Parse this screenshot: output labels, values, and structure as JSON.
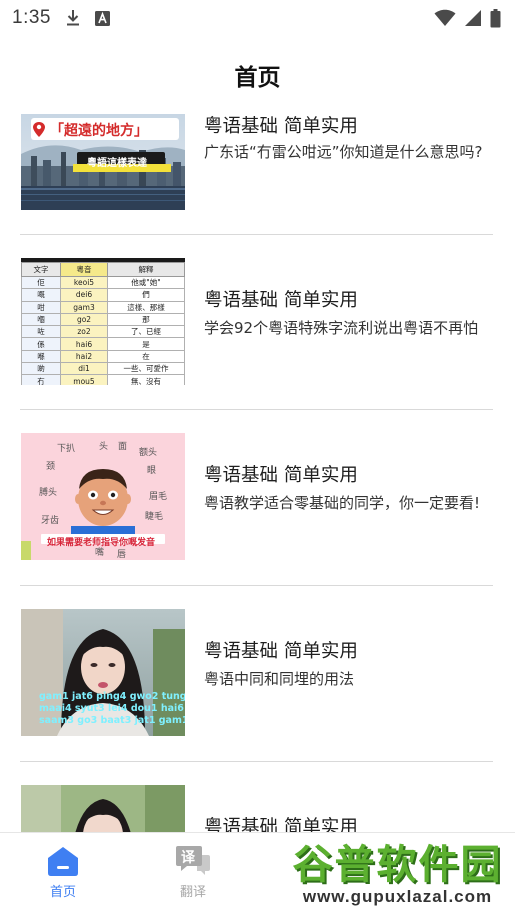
{
  "status_bar": {
    "time": "1:35",
    "icons": [
      "download-icon",
      "font-a-icon",
      "wifi-icon",
      "signal-icon",
      "battery-icon"
    ]
  },
  "header": {
    "title": "首页"
  },
  "items": [
    {
      "title": "粤语基础 简单实用",
      "description": "广东话“冇雷公咁远”你知道是什么意思吗?",
      "thumbnail": {
        "caption": "「超遠的地方」",
        "subcaption": "粵語這樣表達"
      }
    },
    {
      "title": "粤语基础 简单实用",
      "description": "学会92个粤语特殊字流利说出粤语不再怕",
      "thumbnail": {
        "table_header": [
          "文字",
          "粵音",
          "解釋"
        ],
        "table_rows": [
          [
            "佢",
            "keoi5",
            "他或\"她\""
          ],
          [
            "嘅",
            "dei6",
            "們"
          ],
          [
            "咁",
            "gam3",
            "這樣、那樣"
          ],
          [
            "嗰",
            "go2",
            "那"
          ],
          [
            "咗",
            "zo2",
            "了、已經"
          ],
          [
            "係",
            "hai6",
            "是"
          ],
          [
            "喺",
            "hai2",
            "在"
          ],
          [
            "啲",
            "di1",
            "一些、可愛作"
          ],
          [
            "冇",
            "mou5",
            "無、沒有"
          ]
        ]
      }
    },
    {
      "title": "粤语基础 简单实用",
      "description": "粤语教学适合零基础的同学，你一定要看!",
      "thumbnail": {
        "labels": [
          "下扒",
          "头",
          "面",
          "额头",
          "颈",
          "眼",
          "膊头",
          "眉毛",
          "牙齿",
          "睫毛",
          "嘴",
          "唇"
        ],
        "banner": "如果需要老师指导你嘅发音"
      }
    },
    {
      "title": "粤语基础 简单实用",
      "description": "粤语中同和同埋的用法",
      "thumbnail": {
        "subtitle_lines": [
          "gam1 jat6 ping4 gwo2 tung4",
          "maai4 syut3 lei4 dou1 hai6",
          "saam3 go3 baat3 jat1 gam1"
        ]
      }
    },
    {
      "title": "粤语基础 简单实用",
      "description": ""
    }
  ],
  "bottom_nav": {
    "tabs": [
      {
        "label": "首页",
        "icon": "home-icon",
        "active": true
      },
      {
        "label": "翻译",
        "icon": "translate-chat-icon",
        "active": false,
        "icon_text": "译"
      }
    ]
  },
  "watermark": {
    "brand": "谷普软件园",
    "url": "www.gupuxlazal.com"
  },
  "colors": {
    "accent": "#3f7ff2",
    "inactive": "#a8a8a8",
    "divider": "#d9d9d9"
  }
}
